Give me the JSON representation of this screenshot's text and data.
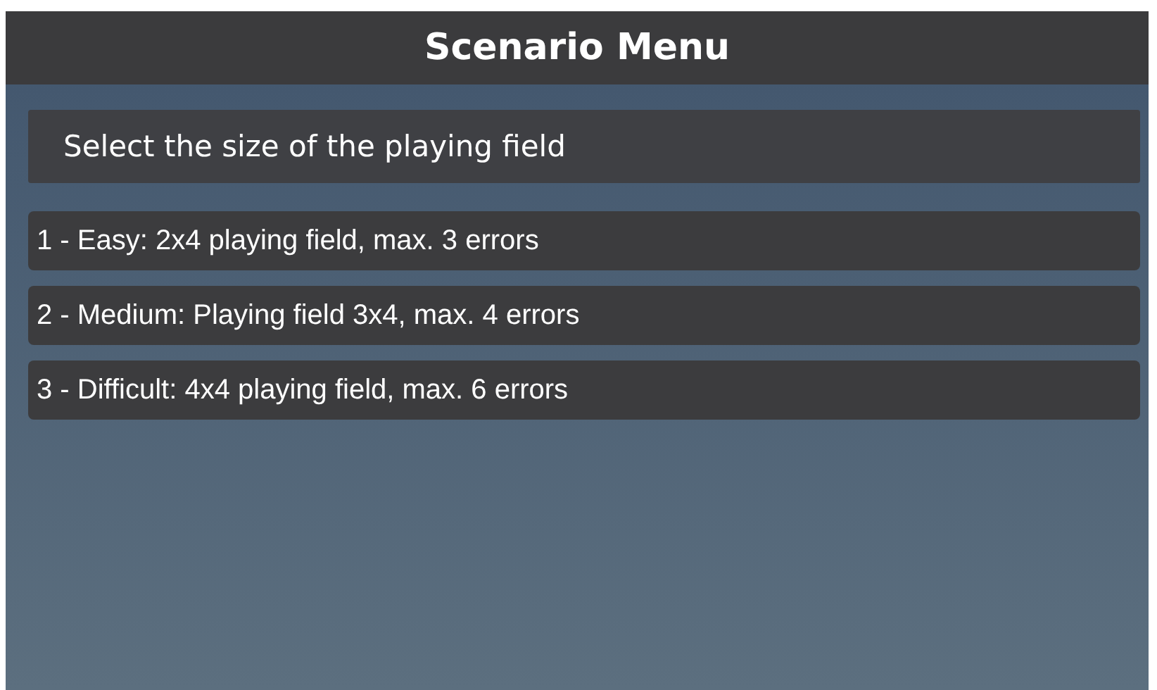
{
  "window": {
    "title": "Scenario Menu"
  },
  "prompt": "Select the size of the playing field",
  "options": [
    {
      "label": "1 - Easy: 2x4 playing field, max. 3 errors"
    },
    {
      "label": "2 - Medium: Playing field 3x4, max. 4 errors"
    },
    {
      "label": "3 - Difficult: 4x4 playing field, max. 6 errors"
    }
  ]
}
